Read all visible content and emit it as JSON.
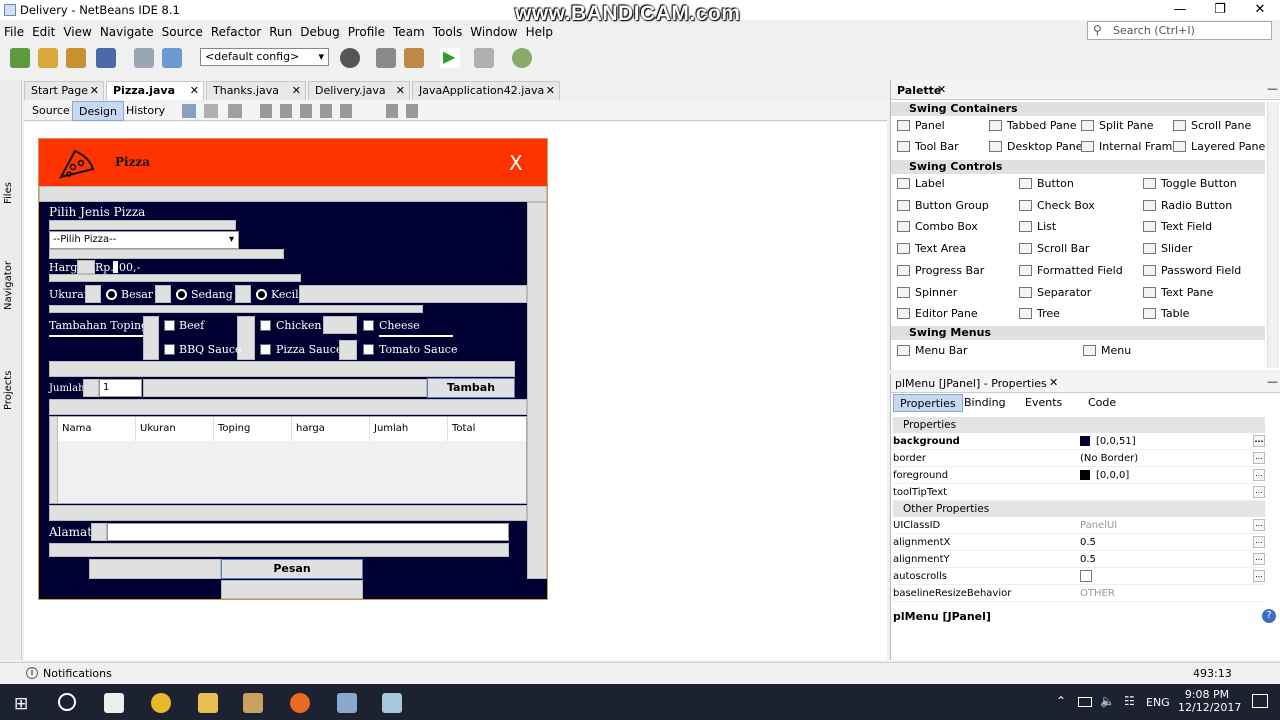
{
  "window": {
    "title": "Delivery - NetBeans IDE 8.1"
  },
  "watermark": "www.BANDICAM.com",
  "menu": [
    "File",
    "Edit",
    "View",
    "Navigate",
    "Source",
    "Refactor",
    "Run",
    "Debug",
    "Profile",
    "Team",
    "Tools",
    "Window",
    "Help"
  ],
  "search": {
    "placeholder": "Search (Ctrl+I)"
  },
  "toolbar": {
    "config": "<default config>"
  },
  "editor_tabs": [
    {
      "label": "Start Page"
    },
    {
      "label": "Pizza.java"
    },
    {
      "label": "Thanks.java"
    },
    {
      "label": "Delivery.java"
    },
    {
      "label": "JavaApplication42.java"
    }
  ],
  "editor_modes": [
    "Source",
    "Design",
    "History"
  ],
  "side_labels": [
    "Files",
    "Navigator",
    "Projects"
  ],
  "form": {
    "title": "Pizza",
    "close": "X",
    "pilih_label": "Pilih Jenis Pizza",
    "combo_value": "--Pilih Pizza--",
    "harga_label": "Harga",
    "harga_value": "Rp.",
    "harga_suffix": "00,-",
    "ukuran_label": "Ukuran",
    "ukuran_options": [
      "Besar",
      "Sedang",
      "Kecil"
    ],
    "toping_label": "Tambahan Toping",
    "toping_options": [
      "Beef",
      "Chicken",
      "Cheese",
      "BBQ Sauce",
      "Pizza Sauce",
      "Tomato Sauce"
    ],
    "jumlah_label": "Jumlah",
    "jumlah_value": "1",
    "tambah_button": "Tambah",
    "table_headers": [
      "Nama",
      "Ukuran",
      "Toping",
      "harga",
      "Jumlah",
      "Total"
    ],
    "alamat_label": "Alamat",
    "pesan_button": "Pesan"
  },
  "palette": {
    "title": "Palette",
    "categories": [
      {
        "name": "Swing Containers",
        "items": [
          "Panel",
          "Tabbed Pane",
          "Split Pane",
          "Scroll Pane",
          "Tool Bar",
          "Desktop Pane",
          "Internal Frame",
          "Layered Pane"
        ]
      },
      {
        "name": "Swing Controls",
        "items": [
          "Label",
          "Button",
          "Toggle Button",
          "Button Group",
          "Check Box",
          "Radio Button",
          "Combo Box",
          "List",
          "Text Field",
          "Text Area",
          "Scroll Bar",
          "Slider",
          "Progress Bar",
          "Formatted Field",
          "Password Field",
          "Spinner",
          "Separator",
          "Text Pane",
          "Editor Pane",
          "Tree",
          "Table"
        ]
      },
      {
        "name": "Swing Menus",
        "items": [
          "Menu Bar",
          "Menu"
        ]
      }
    ]
  },
  "properties": {
    "title": "plMenu [JPanel] - Properties",
    "tabs": [
      "Properties",
      "Binding",
      "Events",
      "Code"
    ],
    "section1": "Properties",
    "rows1": [
      {
        "key": "background",
        "value": "[0,0,51]",
        "swatch": "#000033"
      },
      {
        "key": "border",
        "value": "(No Border)"
      },
      {
        "key": "foreground",
        "value": "[0,0,0]",
        "swatch": "#000000"
      },
      {
        "key": "toolTipText",
        "value": ""
      }
    ],
    "section2": "Other Properties",
    "rows2": [
      {
        "key": "UIClassID",
        "value": "PanelUI"
      },
      {
        "key": "alignmentX",
        "value": "0.5"
      },
      {
        "key": "alignmentY",
        "value": "0.5"
      },
      {
        "key": "autoscrolls",
        "value": ""
      },
      {
        "key": "baselineResizeBehavior",
        "value": "OTHER"
      }
    ],
    "footer": "plMenu [JPanel]"
  },
  "status": {
    "notifications": "Notifications",
    "position": "493:13"
  },
  "taskbar": {
    "lang": "ENG",
    "time": "9:08 PM",
    "date": "12/12/2017"
  }
}
